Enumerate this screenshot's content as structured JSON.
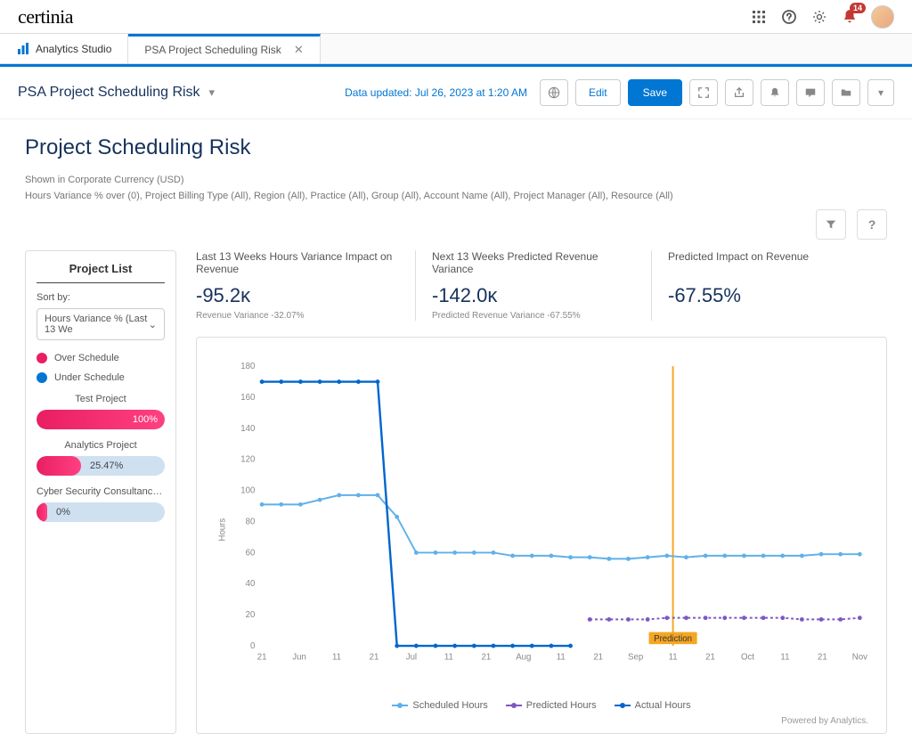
{
  "brand": "certinia",
  "notifications_count": "14",
  "tabs": {
    "studio": "Analytics Studio",
    "active": "PSA Project Scheduling Risk"
  },
  "page_header": {
    "title": "PSA Project Scheduling Risk",
    "data_updated": "Data updated: Jul 26, 2023 at 1:20 AM",
    "edit": "Edit",
    "save": "Save"
  },
  "dashboard": {
    "title": "Project Scheduling Risk",
    "currency_note": "Shown in Corporate Currency (USD)",
    "filters_note": "Hours Variance % over (0), Project Billing Type (All), Region (All), Practice (All), Group (All), Account Name (All), Project Manager (All), Resource (All)"
  },
  "sidebar": {
    "title": "Project List",
    "sort_label": "Sort by:",
    "sort_value": "Hours Variance % (Last 13 We",
    "legend": {
      "over": "Over Schedule",
      "under": "Under Schedule"
    },
    "projects": [
      {
        "name": "Test Project",
        "pct": "100%",
        "width": 100
      },
      {
        "name": "Analytics Project",
        "pct": "25.47%",
        "width": 35
      },
      {
        "name": "Cyber Security Consultancy - Multi...",
        "pct": "0%",
        "width": 8
      }
    ]
  },
  "kpis": [
    {
      "label": "Last 13 Weeks Hours Variance Impact on Revenue",
      "value": "-95.2ᴋ",
      "sub": "Revenue Variance -32.07%"
    },
    {
      "label": "Next 13 Weeks Predicted Revenue Variance",
      "value": "-142.0ᴋ",
      "sub": "Predicted Revenue Variance -67.55%"
    },
    {
      "label": "Predicted Impact on Revenue",
      "value": "-67.55%",
      "sub": ""
    }
  ],
  "chart": {
    "legend": {
      "scheduled": "Scheduled Hours",
      "predicted": "Predicted Hours",
      "actual": "Actual Hours"
    },
    "ylabel": "Hours",
    "prediction_label": "Prediction",
    "powered": "Powered by Analytics."
  },
  "chart_data": {
    "type": "line",
    "ylabel": "Hours",
    "ylim": [
      0,
      180
    ],
    "x_labels": [
      "21",
      "Jun",
      "11",
      "21",
      "Jul",
      "11",
      "21",
      "Aug",
      "11",
      "21",
      "Sep",
      "11",
      "21",
      "Oct",
      "11",
      "21",
      "Nov"
    ],
    "prediction_boundary_index": 11,
    "series": [
      {
        "name": "Scheduled Hours",
        "color": "#5fb1e8",
        "values": [
          91,
          91,
          91,
          94,
          97,
          97,
          97,
          83,
          60,
          60,
          60,
          60,
          60,
          58,
          58,
          58,
          57,
          57,
          56,
          56,
          57,
          58,
          57,
          58,
          58,
          58,
          58,
          58,
          58,
          59,
          59,
          59
        ]
      },
      {
        "name": "Actual Hours",
        "color": "#0066cc",
        "values": [
          170,
          170,
          170,
          170,
          170,
          170,
          170,
          0,
          0,
          0,
          0,
          0,
          0,
          0,
          0,
          0,
          0,
          null,
          null,
          null,
          null,
          null,
          null,
          null,
          null,
          null,
          null,
          null,
          null,
          null,
          null,
          null
        ]
      },
      {
        "name": "Predicted Hours",
        "color": "#7e57c2",
        "values": [
          null,
          null,
          null,
          null,
          null,
          null,
          null,
          null,
          null,
          null,
          null,
          null,
          null,
          null,
          null,
          null,
          null,
          17,
          17,
          17,
          17,
          18,
          18,
          18,
          18,
          18,
          18,
          18,
          17,
          17,
          17,
          18
        ]
      }
    ]
  },
  "colors": {
    "over": "#e91e63",
    "under": "#0176d3",
    "scheduled": "#5fb1e8",
    "actual": "#0066cc",
    "predicted": "#7e57c2",
    "prediction_line": "#f5a623"
  }
}
